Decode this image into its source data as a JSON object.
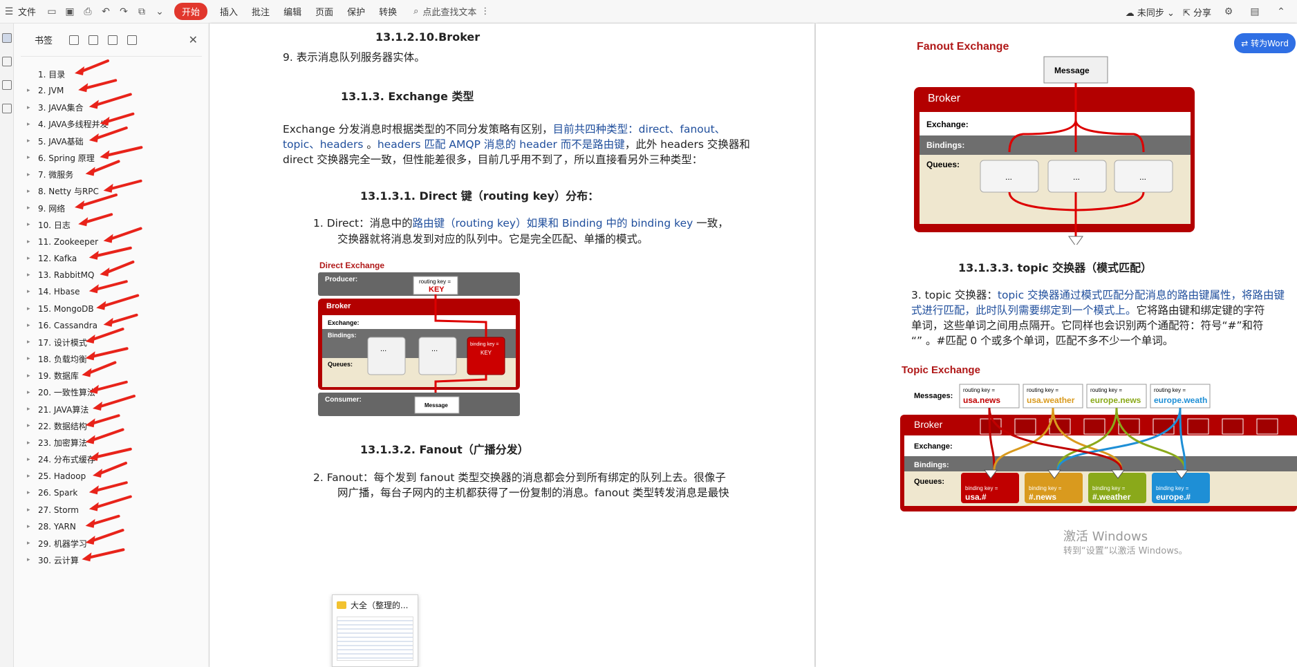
{
  "toolbar": {
    "file": "文件",
    "tabs": [
      "开始",
      "插入",
      "批注",
      "编辑",
      "页面",
      "保护",
      "转换"
    ],
    "search_placeholder": "点此查找文本",
    "sync": "未同步",
    "share": "分享"
  },
  "bookmarks": {
    "title": "书签",
    "items": [
      "1. 目录",
      "2. JVM",
      "3. JAVA集合",
      "4. JAVA多线程并发",
      "5. JAVA基础",
      "6. Spring 原理",
      "7.   微服务",
      "8. Netty 与RPC",
      "9. 网络",
      "10. 日志",
      "11. Zookeeper",
      "12. Kafka",
      "13. RabbitMQ",
      "14. Hbase",
      "15. MongoDB",
      "16. Cassandra",
      "17. 设计模式",
      "18. 负载均衡",
      "19. 数据库",
      "20. 一致性算法",
      "21. JAVA算法",
      "22. 数据结构",
      "23. 加密算法",
      "24. 分布式缓存",
      "25. Hadoop",
      "26. Spark",
      "27. Storm",
      "28. YARN",
      "29. 机器学习",
      "30. 云计算"
    ]
  },
  "page1": {
    "h_broker": "13.1.2.10.Broker",
    "p9": "9.    表示消息队列服务器实体。",
    "h_exchange": "13.1.3.     Exchange 类型",
    "para_a1": "Exchange 分发消息时根据类型的不同分发策略有区别，",
    "para_a2": "目前共四种类型：direct、fanout、",
    "para_b1": "topic、headers",
    "para_b2": " 。",
    "para_b3": "headers 匹配 AMQP 消息的 header 而不是路由键",
    "para_b4": "，此外 headers 交换器和",
    "para_c": "direct 交换器完全一致，但性能差很多，目前几乎用不到了，所以直接看另外三种类型：",
    "h_direct": "13.1.3.1.  Direct 键（routing key）分布：",
    "d1_a": "1.     Direct：消息中的",
    "d1_b": "路由键（routing key）如果和 Binding 中的 binding key",
    "d1_c": " 一致，",
    "d2": "交换器就将消息发到对应的队列中。它是完全匹配、单播的模式。",
    "h_fanout": "13.1.3.2.  Fanout（广播分发）",
    "f1": "2.     Fanout：每个发到 fanout 类型交换器的消息都会分到所有绑定的队列上去。很像子",
    "f2": "网广播，每台子网内的主机都获得了一份复制的消息。fanout 类型转发消息是最快"
  },
  "direct_fig": {
    "title": "Direct Exchange",
    "producer": "Producer:",
    "routing_key": "routing key =",
    "key": "KEY",
    "broker": "Broker",
    "exchange": "Exchange:",
    "bindings": "Bindings:",
    "queues": "Queues:",
    "dots": "...",
    "binding_key": "binding key =",
    "bkey": "KEY",
    "consumer": "Consumer:",
    "message": "Message"
  },
  "fanout_fig": {
    "title": "Fanout Exchange",
    "message": "Message",
    "broker": "Broker",
    "exchange": "Exchange:",
    "bindings": "Bindings:",
    "queues": "Queues:",
    "dots": "..."
  },
  "page2": {
    "h_topic": "13.1.3.3.          topic 交换器（模式匹配）",
    "t1_a": "3.     topic 交换器：",
    "t1_b": "topic 交换器通过模式匹配分配消息的路由键属性，将路由键",
    "t2_a": "式进行匹配，此时队列需要绑定到一个模式上。",
    "t2_b": "它将路由键和绑定键的字符",
    "t3": "单词，这些单词之间用点隔开。它同样也会识别两个通配符：符号“#”和符",
    "t4": "“”  。#匹配 0 个或多个单词，匹配不多不少一个单词。",
    "to_word": "转为Word"
  },
  "topic_fig": {
    "title": "Topic Exchange",
    "messages": "Messages:",
    "rk_label": "routing key =",
    "rks": [
      "usa.news",
      "usa.weather",
      "europe.news",
      "europe.weath"
    ],
    "broker": "Broker",
    "exchange": "Exchange:",
    "bindings": "Bindings:",
    "queues": "Queues:",
    "bk_label": "binding key =",
    "bks": [
      "usa.#",
      "#.news",
      "#.weather",
      "europe.#"
    ],
    "colors": [
      "#c00000",
      "#d99a1e",
      "#8aa91a",
      "#1e8fd6"
    ]
  },
  "watermark": {
    "line1": "激活 Windows",
    "line2": "转到“设置”以激活 Windows。"
  },
  "thumbnail": {
    "label": "大全（整理的..."
  }
}
